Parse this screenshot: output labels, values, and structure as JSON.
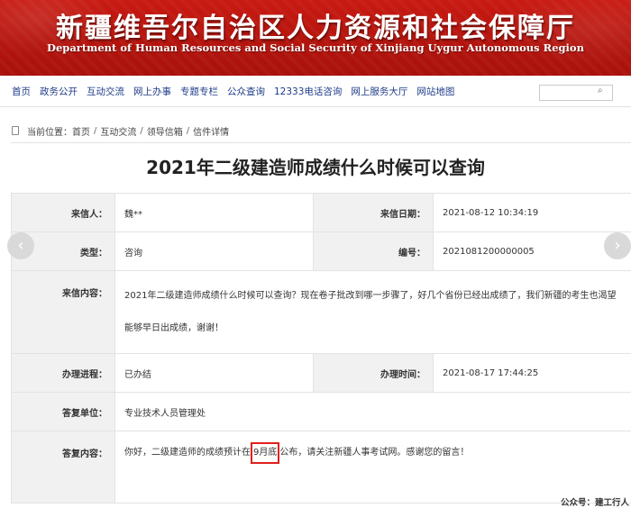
{
  "header": {
    "title": "新疆维吾尔自治区人力资源和社会保障厅",
    "subtitle": "Department of Human Resources and Social Security of Xinjiang Uygur Autonomous Region"
  },
  "nav": {
    "items": [
      "首页",
      "政务公开",
      "互动交流",
      "网上办事",
      "专题专栏",
      "公众查询",
      "12333电话咨询",
      "网上服务大厅",
      "网站地图"
    ],
    "search_placeholder": ""
  },
  "breadcrumb": {
    "prefix": "当前位置：",
    "items": [
      "首页",
      "互动交流",
      "领导信箱",
      "信件详情"
    ],
    "separator": "/"
  },
  "letter": {
    "title": "2021年二级建造师成绩什么时候可以查询",
    "sender_label": "来信人：",
    "sender": "魏**",
    "date_label": "来信日期：",
    "date": "2021-08-12 10:34:19",
    "type_label": "类型：",
    "type": "咨询",
    "number_label": "编号：",
    "number": "2021081200000005",
    "content_label": "来信内容：",
    "content_line1": "2021年二级建造师成绩什么时候可以查询？现在卷子批改到哪一步骤了，好几个省份已经出成绩了，我们新疆的考生也渴望",
    "content_line2": "能够早日出成绩，谢谢！",
    "progress_label": "办理进程：",
    "progress": "已办结",
    "handle_time_label": "办理时间：",
    "handle_time": "2021-08-17 17:44:25",
    "reply_unit_label": "答复单位：",
    "reply_unit": "专业技术人员管理处",
    "reply_label": "答复内容：",
    "reply_before": "你好，二级建造师的成绩预计在",
    "reply_highlight": "9月底",
    "reply_after": "公布，请关注新疆人事考试网。感谢您的留言！"
  },
  "footer": {
    "account_label": "公众号：",
    "account": "建工行人"
  },
  "colors": {
    "banner": "#b3140d",
    "nav_text": "#1f3c88",
    "highlight_box": "#e0201c"
  }
}
